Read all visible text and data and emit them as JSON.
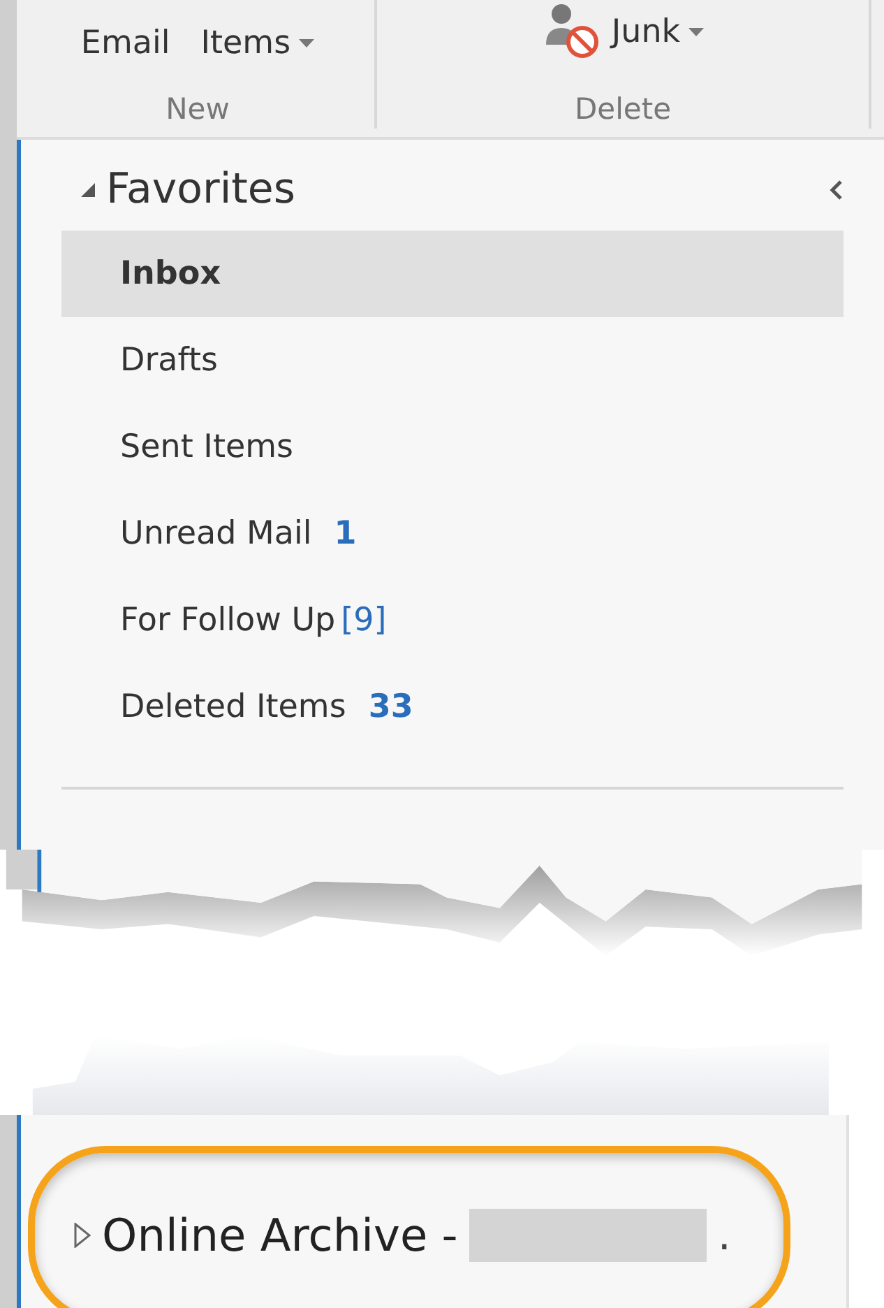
{
  "ribbon": {
    "groups": [
      {
        "label": "New",
        "buttons": [
          {
            "label": "Email",
            "kind": "text",
            "dropdown": false
          },
          {
            "label": "Items",
            "kind": "text",
            "dropdown": true
          }
        ]
      },
      {
        "label": "Delete",
        "buttons": [
          {
            "label": "Junk",
            "kind": "junk",
            "dropdown": true
          }
        ]
      }
    ]
  },
  "favorites": {
    "title": "Favorites",
    "expanded": true,
    "items": [
      {
        "label": "Inbox",
        "selected": true
      },
      {
        "label": "Drafts",
        "selected": false
      },
      {
        "label": "Sent Items",
        "selected": false
      },
      {
        "label": "Unread Mail",
        "selected": false,
        "count": "1",
        "count_bold": true
      },
      {
        "label": "For Follow Up",
        "selected": false,
        "count": "[9]",
        "count_bold": false
      },
      {
        "label": "Deleted Items",
        "selected": false,
        "count": "33",
        "count_bold": true
      }
    ]
  },
  "archive": {
    "label": "Online Archive -",
    "suffix": ".",
    "expanded": false,
    "redacted": true
  }
}
